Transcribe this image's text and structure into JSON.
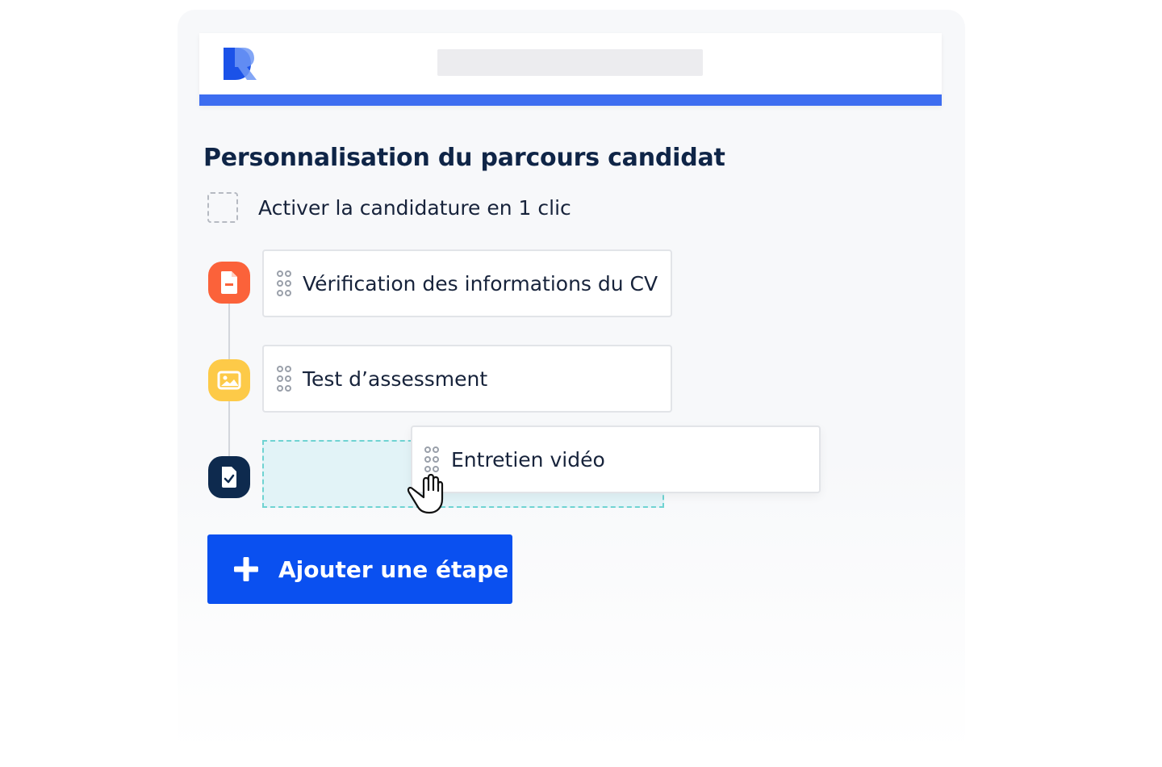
{
  "header": {
    "logo_icon": "brand-logo-icon",
    "search_placeholder": ""
  },
  "main": {
    "title": "Personnalisation du parcours candidat",
    "one_click": {
      "label": "Activer la candidature en 1 clic",
      "checked": false
    },
    "steps": [
      {
        "icon": "document-icon",
        "color": "#fb623a",
        "label": "Vérification des informations du CV"
      },
      {
        "icon": "image-icon",
        "color": "#fdca48",
        "label": "Test d’assessment"
      },
      {
        "icon": "checklist-icon",
        "color": "#0e2a4e",
        "label": "Entretien vidéo",
        "state": "dragging"
      }
    ],
    "add_button": {
      "label": "Ajouter une étape",
      "icon": "plus-icon"
    }
  },
  "colors": {
    "accent": "#3d6df0",
    "button": "#0a50f0",
    "title": "#0f2547",
    "dropzone_border": "#6fd3d2"
  }
}
